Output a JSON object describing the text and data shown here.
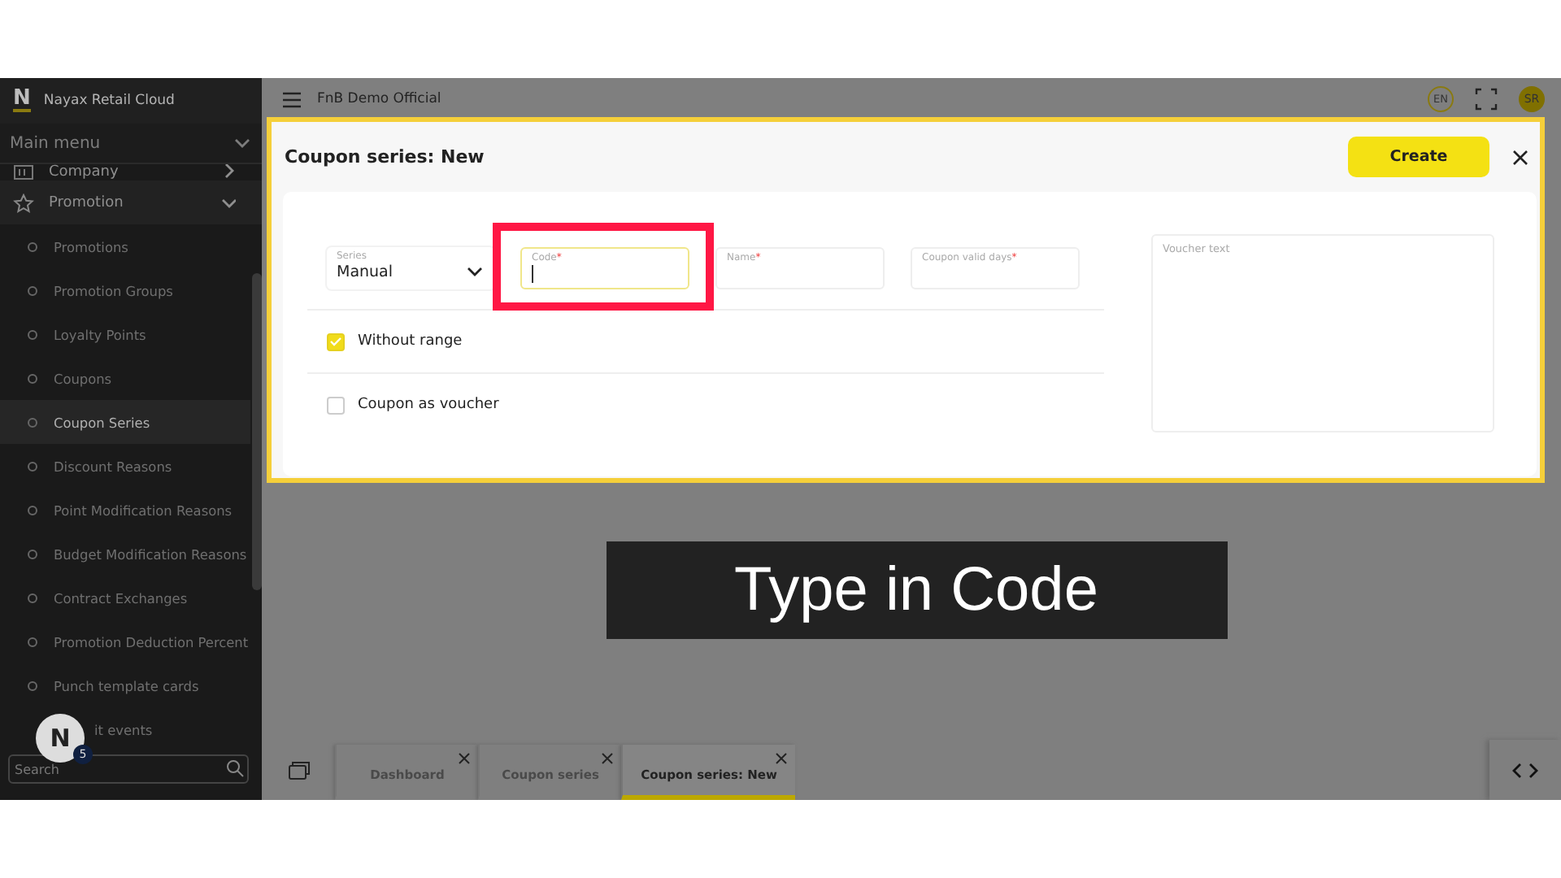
{
  "sidebar": {
    "logo": "N",
    "brand": "Nayax Retail Cloud",
    "menu_title": "Main menu",
    "items": [
      {
        "label": "Company",
        "expanded": false
      },
      {
        "label": "Promotion",
        "expanded": true,
        "children": [
          {
            "label": "Promotions",
            "selected": false
          },
          {
            "label": "Promotion Groups",
            "selected": false
          },
          {
            "label": "Loyalty Points",
            "selected": false
          },
          {
            "label": "Coupons",
            "selected": false
          },
          {
            "label": "Coupon Series",
            "selected": true
          },
          {
            "label": "Discount Reasons",
            "selected": false
          },
          {
            "label": "Point Modification Reasons",
            "selected": false
          },
          {
            "label": "Budget Modification Reasons",
            "selected": false
          },
          {
            "label": "Contract Exchanges",
            "selected": false
          },
          {
            "label": "Promotion Deduction Percent",
            "selected": false
          },
          {
            "label": "Punch template cards",
            "selected": false
          },
          {
            "label": "it events",
            "selected": false
          }
        ]
      }
    ],
    "search": {
      "placeholder": "Search"
    },
    "assistant": {
      "logo": "N",
      "count": "5"
    }
  },
  "topbar": {
    "company": "FnB Demo Official",
    "language": "EN",
    "avatar": "SR"
  },
  "modal": {
    "title": "Coupon series: New",
    "create_button": "Create",
    "fields": [
      {
        "kind": "select",
        "label": "Series",
        "value": "Manual"
      },
      {
        "kind": "text",
        "label": "Code",
        "required_mark": "*",
        "focused": true
      },
      {
        "kind": "text",
        "label": "Name",
        "required_mark": "*",
        "focused": false
      },
      {
        "kind": "text",
        "label": "Coupon valid days",
        "required_mark": "*",
        "focused": false
      }
    ],
    "checkboxes": [
      {
        "label": "Without range",
        "checked": true
      },
      {
        "label": "Coupon as voucher",
        "checked": false
      }
    ],
    "voucher_text": {
      "placeholder": "Voucher text"
    }
  },
  "tabs": [
    {
      "label": "Dashboard",
      "selected": false
    },
    {
      "label": "Coupon series",
      "selected": false
    },
    {
      "label": "Coupon series: New",
      "selected": true
    }
  ],
  "caption": "Type in Code"
}
